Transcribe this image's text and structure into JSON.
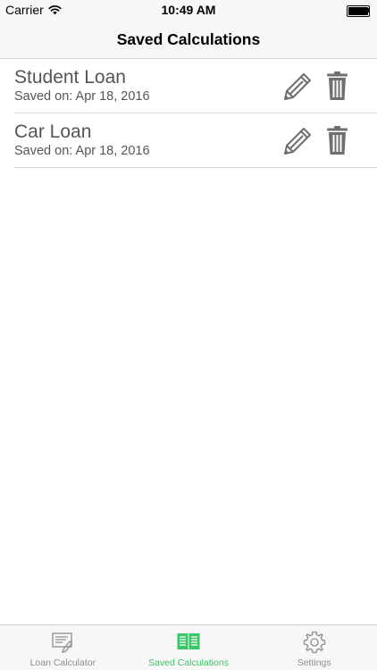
{
  "status_bar": {
    "carrier": "Carrier",
    "time": "10:49 AM",
    "wifi_icon": "wifi-icon",
    "battery_icon": "battery-icon"
  },
  "nav_bar": {
    "title": "Saved Calculations"
  },
  "saved_list": [
    {
      "title": "Student Loan",
      "saved_on": "Saved on: Apr 18, 2016",
      "edit_icon": "pencil-icon",
      "delete_icon": "trash-icon"
    },
    {
      "title": "Car Loan",
      "saved_on": "Saved on: Apr 18, 2016",
      "edit_icon": "pencil-icon",
      "delete_icon": "trash-icon"
    }
  ],
  "tab_bar": {
    "tabs": [
      {
        "label": "Loan Calculator",
        "icon": "calculator-form-icon",
        "active": false
      },
      {
        "label": "Saved Calculations",
        "icon": "open-book-icon",
        "active": true
      },
      {
        "label": "Settings",
        "icon": "gear-icon",
        "active": false
      }
    ]
  },
  "colors": {
    "accent_active": "#3cc468",
    "tab_inactive": "#8e8e8e",
    "row_text": "#555555",
    "icon_gray": "#6f6f6f",
    "bar_background": "#f7f7f7"
  }
}
